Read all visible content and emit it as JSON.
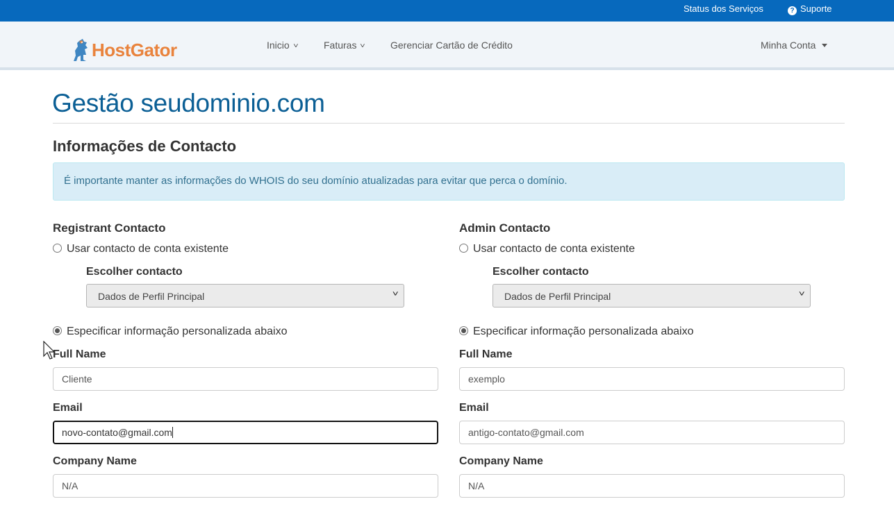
{
  "topbar": {
    "status_link": "Status dos Serviços",
    "support_link": "Suporte",
    "support_icon": "question-circle-icon"
  },
  "header": {
    "logo_text": "HostGator",
    "nav": {
      "inicio": "Inicio",
      "faturas": "Faturas",
      "cartao": "Gerenciar Cartão de Crédito",
      "conta": "Minha Conta"
    }
  },
  "page": {
    "title": "Gestão seudominio.com",
    "section_title": "Informações de Contacto",
    "alert": "É importante manter as informações do WHOIS do seu domínio atualizadas para evitar que perca o domínio."
  },
  "registrant": {
    "heading": "Registrant Contacto",
    "option_existing": "Usar contacto de conta existente",
    "choose_label": "Escolher contacto",
    "choose_value": "Dados de Perfil Principal",
    "option_custom": "Especificar informação personalizada abaixo",
    "full_name_label": "Full Name",
    "full_name_value": "Cliente",
    "email_label": "Email",
    "email_value": "novo-contato@gmail.com",
    "company_label": "Company Name",
    "company_value": "N/A"
  },
  "admin": {
    "heading": "Admin Contacto",
    "option_existing": "Usar contacto de conta existente",
    "choose_label": "Escolher contacto",
    "choose_value": "Dados de Perfil Principal",
    "option_custom": "Especificar informação personalizada abaixo",
    "full_name_label": "Full Name",
    "full_name_value": "exemplo",
    "email_label": "Email",
    "email_value": "antigo-contato@gmail.com",
    "company_label": "Company Name",
    "company_value": "N/A"
  },
  "colors": {
    "topbar": "#0769bd",
    "title": "#0b5f95",
    "logo": "#e9833d",
    "alert_bg": "#d9edf7"
  }
}
